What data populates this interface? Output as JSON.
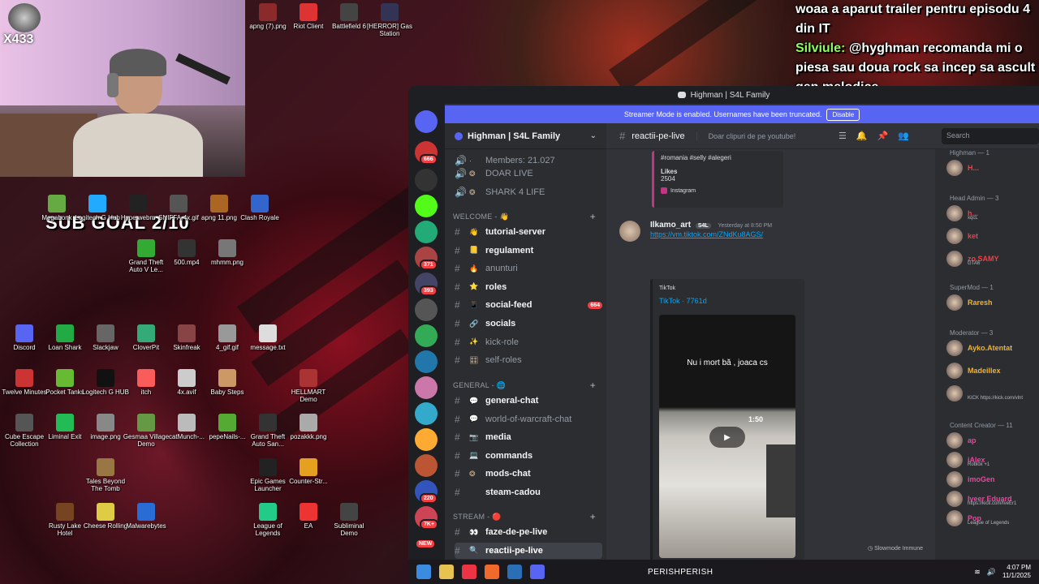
{
  "stream": {
    "corner_tag": "X433",
    "sub_goal": "SUB GOAL 2/10",
    "chat": [
      {
        "name": "",
        "text": "woaa a aparut trailer pentru episodu 4 din IT"
      },
      {
        "name": "Silviule:",
        "text": "@hyghman recomanda mi o piesa sau doua rock sa incep sa ascult gen melodice"
      }
    ]
  },
  "desktop_icons": [
    {
      "label": "apng (7).png",
      "color": "#8a2a2a"
    },
    {
      "label": "Riot Client",
      "color": "#d33"
    },
    {
      "label": "Battlefield 6",
      "color": "#444"
    },
    {
      "label": "[HERROR] Gas Station",
      "color": "#335"
    },
    {
      "label": "Megabonk",
      "color": "#6a4"
    },
    {
      "label": "Logitech G Hub",
      "color": "#2af"
    },
    {
      "label": "Hype.webm",
      "color": "#222"
    },
    {
      "label": "SNIFFA-4x.gif",
      "color": "#555"
    },
    {
      "label": "apng 11.png",
      "color": "#a62"
    },
    {
      "label": "Clash Royale",
      "color": "#36c"
    },
    {
      "label": "Grand Theft Auto V Le...",
      "color": "#3a3"
    },
    {
      "label": "500.mp4",
      "color": "#333"
    },
    {
      "label": "mhmm.png",
      "color": "#777"
    },
    {
      "label": "Discord",
      "color": "#5865f2"
    },
    {
      "label": "Loan Shark",
      "color": "#2a4"
    },
    {
      "label": "Slackjaw",
      "color": "#666"
    },
    {
      "label": "CloverPit",
      "color": "#3a7"
    },
    {
      "label": "Skinfreak",
      "color": "#844"
    },
    {
      "label": "4_gif.gif",
      "color": "#999"
    },
    {
      "label": "message.txt",
      "color": "#ddd"
    },
    {
      "label": "Twelve Minutes",
      "color": "#c33"
    },
    {
      "label": "Pocket Tanks",
      "color": "#6b3"
    },
    {
      "label": "Logitech G HUB",
      "color": "#111"
    },
    {
      "label": "itch",
      "color": "#fa5c5c"
    },
    {
      "label": "4x.avif",
      "color": "#ccc"
    },
    {
      "label": "Baby Steps",
      "color": "#c96"
    },
    {
      "label": "HELLMART Demo",
      "color": "#a33"
    },
    {
      "label": "Cube Escape Collection",
      "color": "#555"
    },
    {
      "label": "Liminal Exit",
      "color": "#2b5"
    },
    {
      "label": "image.png",
      "color": "#888"
    },
    {
      "label": "Gesmaa Village Demo",
      "color": "#694"
    },
    {
      "label": "catMunch-...",
      "color": "#bbb"
    },
    {
      "label": "pepeNails-...",
      "color": "#5a3"
    },
    {
      "label": "Grand Theft Auto San...",
      "color": "#333"
    },
    {
      "label": "pozakkk.png",
      "color": "#aaa"
    },
    {
      "label": "Tales Beyond The Tomb",
      "color": "#974"
    },
    {
      "label": "Epic Games Launcher",
      "color": "#222"
    },
    {
      "label": "Counter-Str...",
      "color": "#e6a020"
    },
    {
      "label": "Rusty Lake Hotel",
      "color": "#742"
    },
    {
      "label": "Cheese Rolling",
      "color": "#dc4"
    },
    {
      "label": "Malwarebytes",
      "color": "#2a6cd6"
    },
    {
      "label": "League of Legends",
      "color": "#2c8"
    },
    {
      "label": "EA",
      "color": "#e33"
    },
    {
      "label": "Subliminal Demo",
      "color": "#444"
    }
  ],
  "discord": {
    "window_title": "Highman | S4L Family",
    "streamer_banner": "Streamer Mode is enabled. Usernames have been truncated.",
    "banner_button": "Disable",
    "server_name": "Highman | S4L Family",
    "server_badges": [
      "666",
      "371",
      "393",
      "220",
      "7K+",
      "NEW"
    ],
    "channels_top": [
      {
        "label": "Members: 21.027",
        "emoji": "·"
      },
      {
        "label": "DOAR LIVE",
        "emoji": "❂"
      },
      {
        "label": "SHARK 4 LIFE",
        "emoji": "❂"
      }
    ],
    "categories": [
      {
        "label": "WELCOME - 👋"
      },
      {
        "label": "GENERAL - 🌐"
      },
      {
        "label": "STREAM - 🔴"
      }
    ],
    "welcome_channels": [
      {
        "label": "tutorial-server",
        "emoji": "👋",
        "unread": true
      },
      {
        "label": "regulament",
        "emoji": "📒",
        "unread": true
      },
      {
        "label": "anunturi",
        "emoji": "🔥",
        "unread": false
      },
      {
        "label": "roles",
        "emoji": "⭐",
        "unread": true
      },
      {
        "label": "social-feed",
        "emoji": "📱",
        "unread": true,
        "badge": "664"
      },
      {
        "label": "socials",
        "emoji": "🔗",
        "unread": true
      },
      {
        "label": "kick-role",
        "emoji": "✨",
        "unread": false
      },
      {
        "label": "self-roles",
        "emoji": "🎛",
        "unread": false
      }
    ],
    "general_channels": [
      {
        "label": "general-chat",
        "emoji": "💬",
        "unread": true
      },
      {
        "label": "world-of-warcraft-chat",
        "emoji": "💬",
        "unread": false
      },
      {
        "label": "media",
        "emoji": "📷",
        "unread": true
      },
      {
        "label": "commands",
        "emoji": "💻",
        "unread": true
      },
      {
        "label": "mods-chat",
        "emoji": "❂",
        "unread": true
      },
      {
        "label": "steam-cadou",
        "emoji": "",
        "unread": true
      }
    ],
    "stream_channels": [
      {
        "label": "faze-de-pe-live",
        "emoji": "👀",
        "unread": true
      },
      {
        "label": "reactii-pe-live",
        "emoji": "🔍",
        "unread": true,
        "selected": true
      }
    ],
    "channel": {
      "name": "reactii-pe-live",
      "topic": "Doar clipuri de pe youtube!",
      "search_placeholder": "Search"
    },
    "prev_embed": {
      "tags": "#romania #selly #alegeri",
      "likes_label": "Likes",
      "likes_value": "2504",
      "footer": "Instagram"
    },
    "message": {
      "author": "Ilkamo_art",
      "tag": "S4L",
      "time": "Yesterday at 8:50 PM",
      "link": "https://vm.tiktok.com/ZNdKu8AGS/",
      "embed_provider": "TikTok",
      "embed_title": "TikTok · 7761d",
      "video_caption": "Nu i mort bă , joaca cs",
      "video_hud": "1:50"
    },
    "slowmode": "Slowmode Immune",
    "members": [
      {
        "role": "Highman — 1",
        "users": [
          {
            "name": "H...",
            "color": "#f23f43"
          }
        ]
      },
      {
        "role": "Head Admin — 3",
        "users": [
          {
            "name": "h...",
            "color": "#f23f43",
            "sub": "xqcL"
          },
          {
            "name": "ket",
            "color": "#f23f43"
          },
          {
            "name": "zo.SAMY",
            "color": "#f23f43",
            "sub": "GTA6"
          }
        ]
      },
      {
        "role": "SuperMod — 1",
        "users": [
          {
            "name": "Raresh",
            "color": "#f0b232"
          }
        ]
      },
      {
        "role": "Moderator — 3",
        "users": [
          {
            "name": "Ayko.Atentat",
            "color": "#f0b232"
          },
          {
            "name": "Madeillex",
            "color": "#f0b232"
          },
          {
            "name": "",
            "color": "#f0b232",
            "sub": "KICK https://kick.com/vlnt"
          }
        ]
      },
      {
        "role": "Content Creator — 11",
        "users": [
          {
            "name": "ap",
            "color": "#eb459e"
          },
          {
            "name": "iAlex",
            "color": "#eb459e",
            "sub": "Roblox +1"
          },
          {
            "name": "imoGen",
            "color": "#eb459e"
          },
          {
            "name": "Iveer Eduard",
            "color": "#eb459e",
            "sub": "https://kick.com/IveEr1"
          },
          {
            "name": "Pop",
            "color": "#eb459e",
            "sub": "League of Legends"
          }
        ]
      }
    ]
  },
  "taskbar": {
    "now_playing": "PERISHPERISH",
    "time": "4:07 PM",
    "date": "11/1/2025"
  }
}
